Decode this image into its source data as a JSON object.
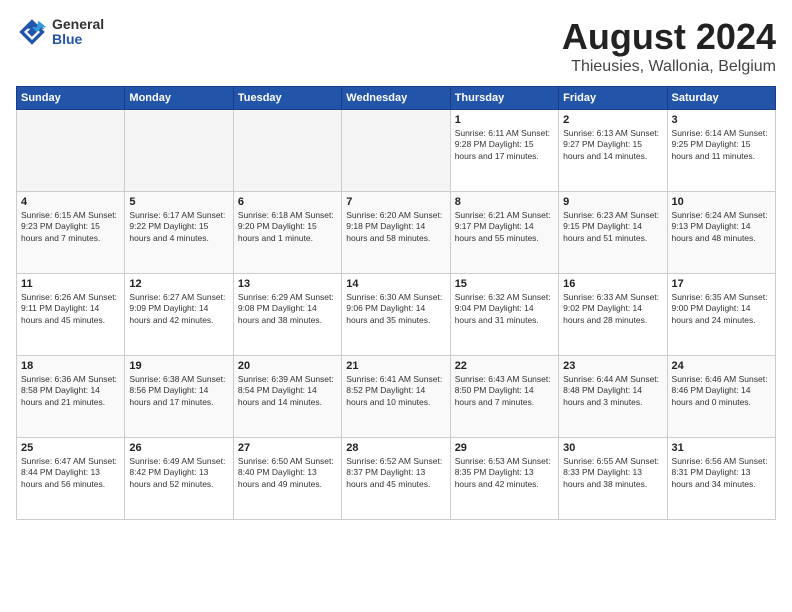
{
  "logo": {
    "general": "General",
    "blue": "Blue"
  },
  "title": "August 2024",
  "location": "Thieusies, Wallonia, Belgium",
  "headers": [
    "Sunday",
    "Monday",
    "Tuesday",
    "Wednesday",
    "Thursday",
    "Friday",
    "Saturday"
  ],
  "weeks": [
    [
      {
        "day": "",
        "text": ""
      },
      {
        "day": "",
        "text": ""
      },
      {
        "day": "",
        "text": ""
      },
      {
        "day": "",
        "text": ""
      },
      {
        "day": "1",
        "text": "Sunrise: 6:11 AM\nSunset: 9:28 PM\nDaylight: 15 hours and 17 minutes."
      },
      {
        "day": "2",
        "text": "Sunrise: 6:13 AM\nSunset: 9:27 PM\nDaylight: 15 hours and 14 minutes."
      },
      {
        "day": "3",
        "text": "Sunrise: 6:14 AM\nSunset: 9:25 PM\nDaylight: 15 hours and 11 minutes."
      }
    ],
    [
      {
        "day": "4",
        "text": "Sunrise: 6:15 AM\nSunset: 9:23 PM\nDaylight: 15 hours and 7 minutes."
      },
      {
        "day": "5",
        "text": "Sunrise: 6:17 AM\nSunset: 9:22 PM\nDaylight: 15 hours and 4 minutes."
      },
      {
        "day": "6",
        "text": "Sunrise: 6:18 AM\nSunset: 9:20 PM\nDaylight: 15 hours and 1 minute."
      },
      {
        "day": "7",
        "text": "Sunrise: 6:20 AM\nSunset: 9:18 PM\nDaylight: 14 hours and 58 minutes."
      },
      {
        "day": "8",
        "text": "Sunrise: 6:21 AM\nSunset: 9:17 PM\nDaylight: 14 hours and 55 minutes."
      },
      {
        "day": "9",
        "text": "Sunrise: 6:23 AM\nSunset: 9:15 PM\nDaylight: 14 hours and 51 minutes."
      },
      {
        "day": "10",
        "text": "Sunrise: 6:24 AM\nSunset: 9:13 PM\nDaylight: 14 hours and 48 minutes."
      }
    ],
    [
      {
        "day": "11",
        "text": "Sunrise: 6:26 AM\nSunset: 9:11 PM\nDaylight: 14 hours and 45 minutes."
      },
      {
        "day": "12",
        "text": "Sunrise: 6:27 AM\nSunset: 9:09 PM\nDaylight: 14 hours and 42 minutes."
      },
      {
        "day": "13",
        "text": "Sunrise: 6:29 AM\nSunset: 9:08 PM\nDaylight: 14 hours and 38 minutes."
      },
      {
        "day": "14",
        "text": "Sunrise: 6:30 AM\nSunset: 9:06 PM\nDaylight: 14 hours and 35 minutes."
      },
      {
        "day": "15",
        "text": "Sunrise: 6:32 AM\nSunset: 9:04 PM\nDaylight: 14 hours and 31 minutes."
      },
      {
        "day": "16",
        "text": "Sunrise: 6:33 AM\nSunset: 9:02 PM\nDaylight: 14 hours and 28 minutes."
      },
      {
        "day": "17",
        "text": "Sunrise: 6:35 AM\nSunset: 9:00 PM\nDaylight: 14 hours and 24 minutes."
      }
    ],
    [
      {
        "day": "18",
        "text": "Sunrise: 6:36 AM\nSunset: 8:58 PM\nDaylight: 14 hours and 21 minutes."
      },
      {
        "day": "19",
        "text": "Sunrise: 6:38 AM\nSunset: 8:56 PM\nDaylight: 14 hours and 17 minutes."
      },
      {
        "day": "20",
        "text": "Sunrise: 6:39 AM\nSunset: 8:54 PM\nDaylight: 14 hours and 14 minutes."
      },
      {
        "day": "21",
        "text": "Sunrise: 6:41 AM\nSunset: 8:52 PM\nDaylight: 14 hours and 10 minutes."
      },
      {
        "day": "22",
        "text": "Sunrise: 6:43 AM\nSunset: 8:50 PM\nDaylight: 14 hours and 7 minutes."
      },
      {
        "day": "23",
        "text": "Sunrise: 6:44 AM\nSunset: 8:48 PM\nDaylight: 14 hours and 3 minutes."
      },
      {
        "day": "24",
        "text": "Sunrise: 6:46 AM\nSunset: 8:46 PM\nDaylight: 14 hours and 0 minutes."
      }
    ],
    [
      {
        "day": "25",
        "text": "Sunrise: 6:47 AM\nSunset: 8:44 PM\nDaylight: 13 hours and 56 minutes."
      },
      {
        "day": "26",
        "text": "Sunrise: 6:49 AM\nSunset: 8:42 PM\nDaylight: 13 hours and 52 minutes."
      },
      {
        "day": "27",
        "text": "Sunrise: 6:50 AM\nSunset: 8:40 PM\nDaylight: 13 hours and 49 minutes."
      },
      {
        "day": "28",
        "text": "Sunrise: 6:52 AM\nSunset: 8:37 PM\nDaylight: 13 hours and 45 minutes."
      },
      {
        "day": "29",
        "text": "Sunrise: 6:53 AM\nSunset: 8:35 PM\nDaylight: 13 hours and 42 minutes."
      },
      {
        "day": "30",
        "text": "Sunrise: 6:55 AM\nSunset: 8:33 PM\nDaylight: 13 hours and 38 minutes."
      },
      {
        "day": "31",
        "text": "Sunrise: 6:56 AM\nSunset: 8:31 PM\nDaylight: 13 hours and 34 minutes."
      }
    ]
  ]
}
